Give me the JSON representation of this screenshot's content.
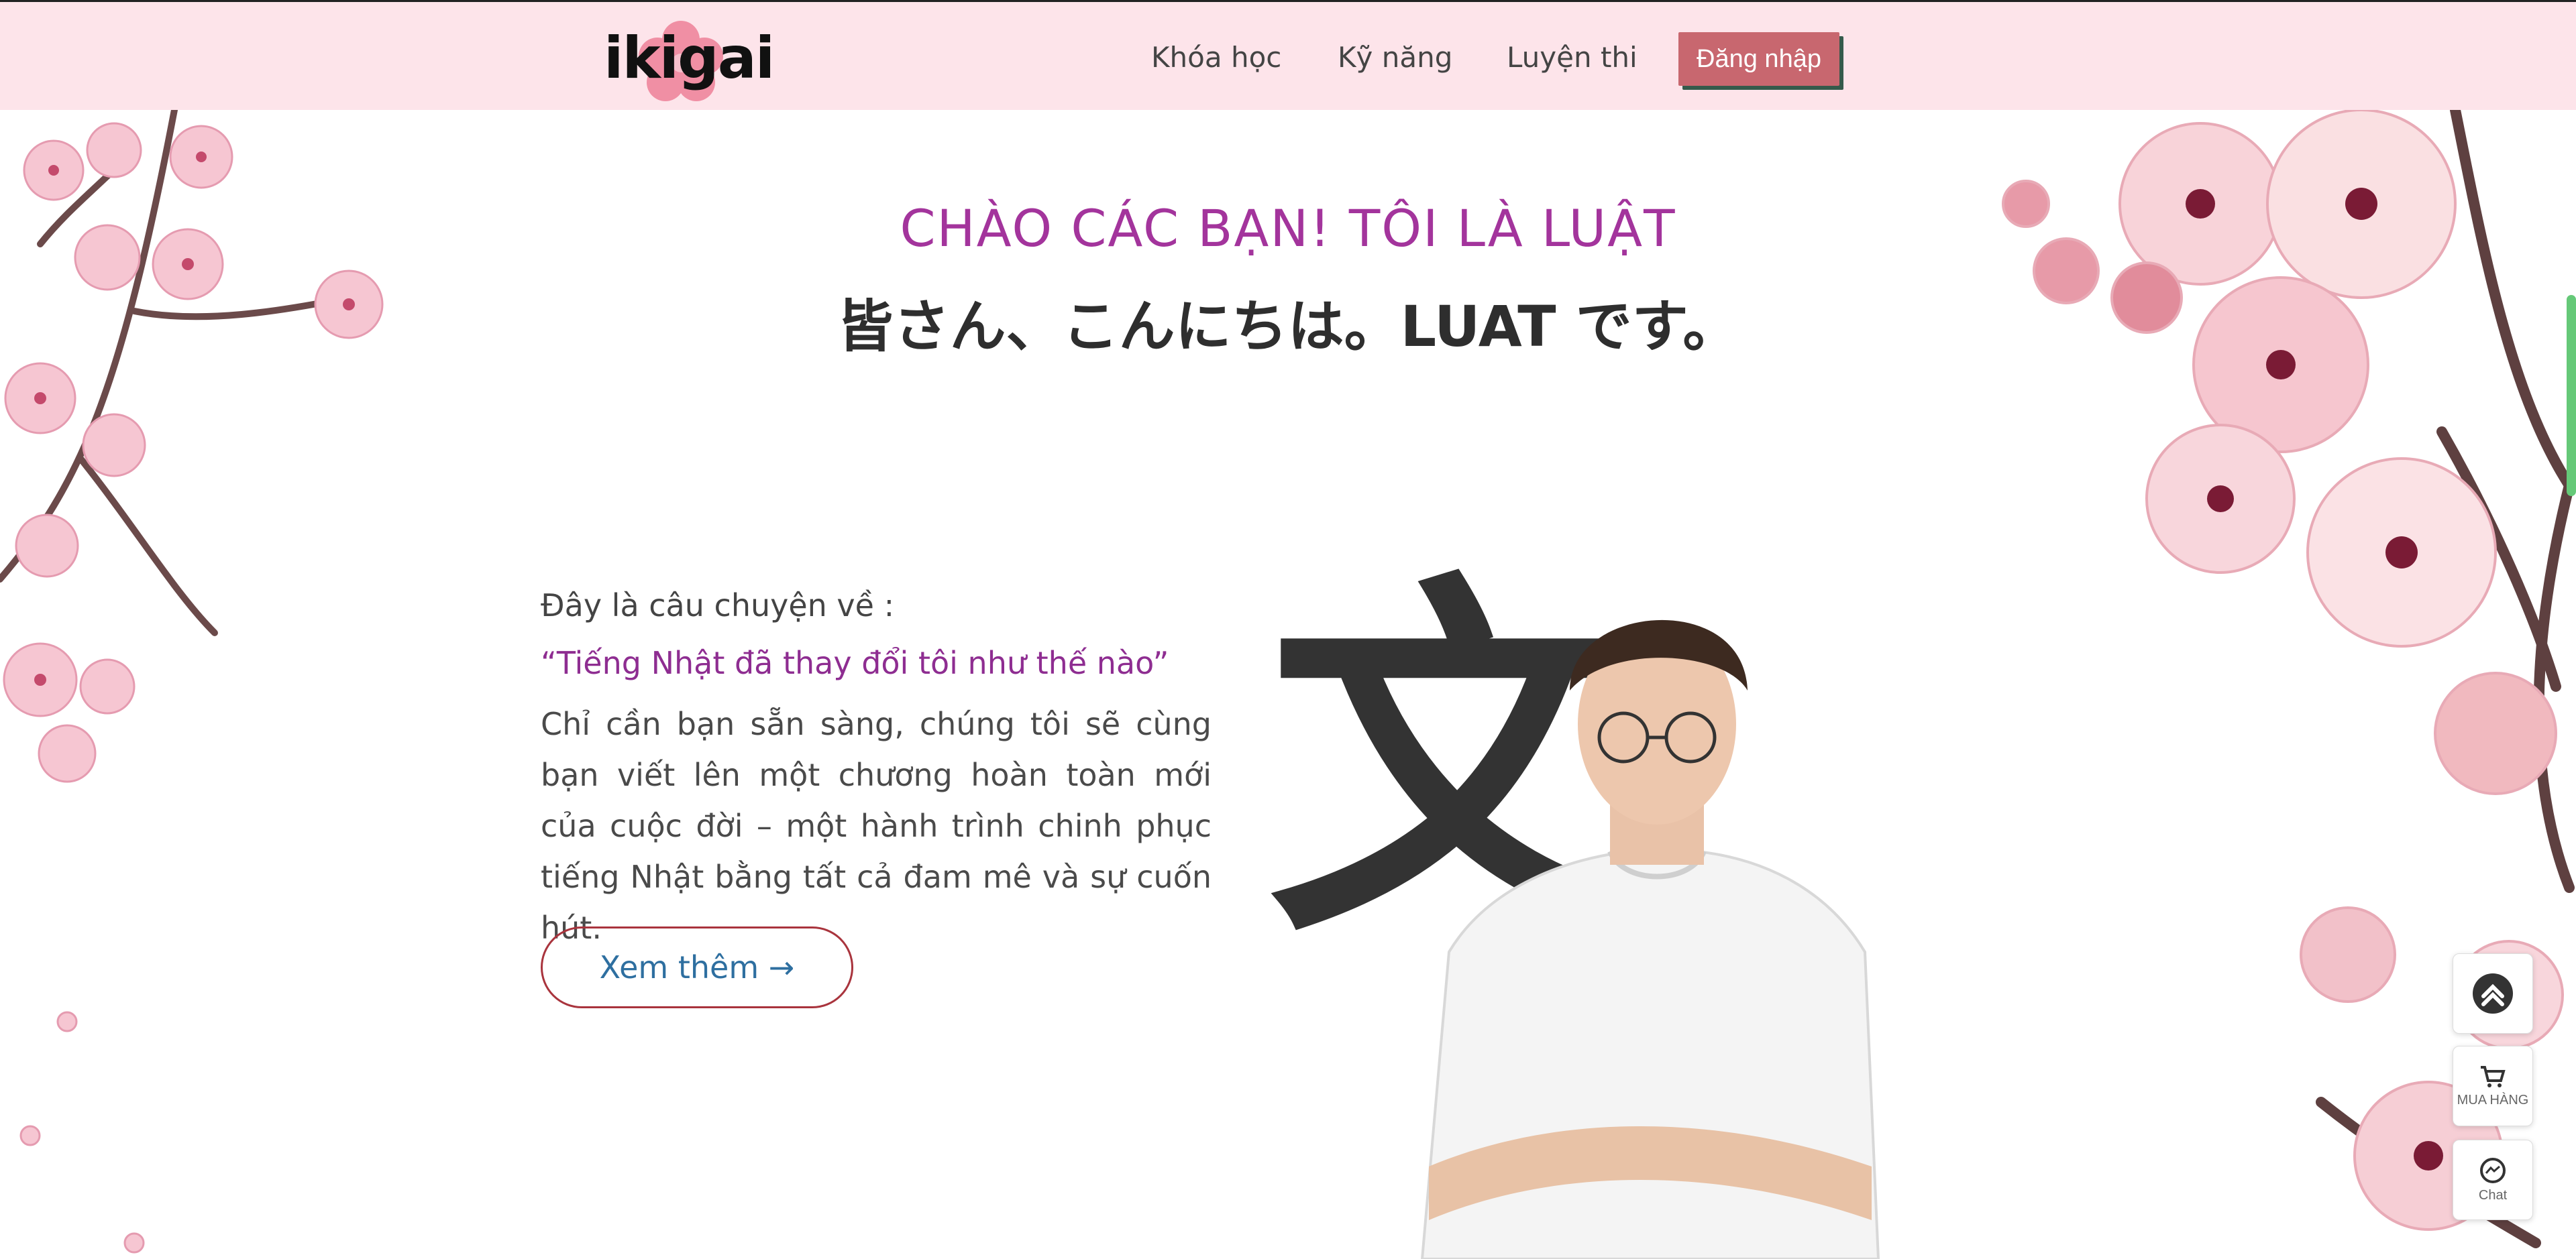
{
  "header": {
    "logo": "ikigai",
    "nav": [
      "Khóa học",
      "Kỹ năng",
      "Luyện thi"
    ],
    "login_label": "Đăng nhập"
  },
  "hero": {
    "greeting_vi": "CHÀO CÁC BẠN! TÔI LÀ LUẬT",
    "greeting_jp": "皆さん、こんにちは。LUAT です。"
  },
  "story": {
    "intro": "Đây là câu chuyện về :",
    "quote": "“Tiếng Nhật đã thay đổi tôi như thế nào”",
    "body": "Chỉ cần bạn sẵn sàng, chúng tôi sẽ cùng bạn viết lên một chương hoàn toàn mới của cuộc đời – một hành trình chinh phục tiếng Nhật bằng tất cả đam mê và sự cuốn hút.",
    "more_label": "Xem thêm →",
    "kanji": "文"
  },
  "floating": {
    "cart_label": "MUA HÀNG",
    "chat_label": "Chat"
  },
  "colors": {
    "header_bg": "#fde4ea",
    "accent_purple": "#a3349c",
    "login_bg": "#c8676f",
    "more_border": "#a9343d"
  },
  "icons": [
    "scroll-top-icon",
    "cart-icon",
    "messenger-icon"
  ]
}
